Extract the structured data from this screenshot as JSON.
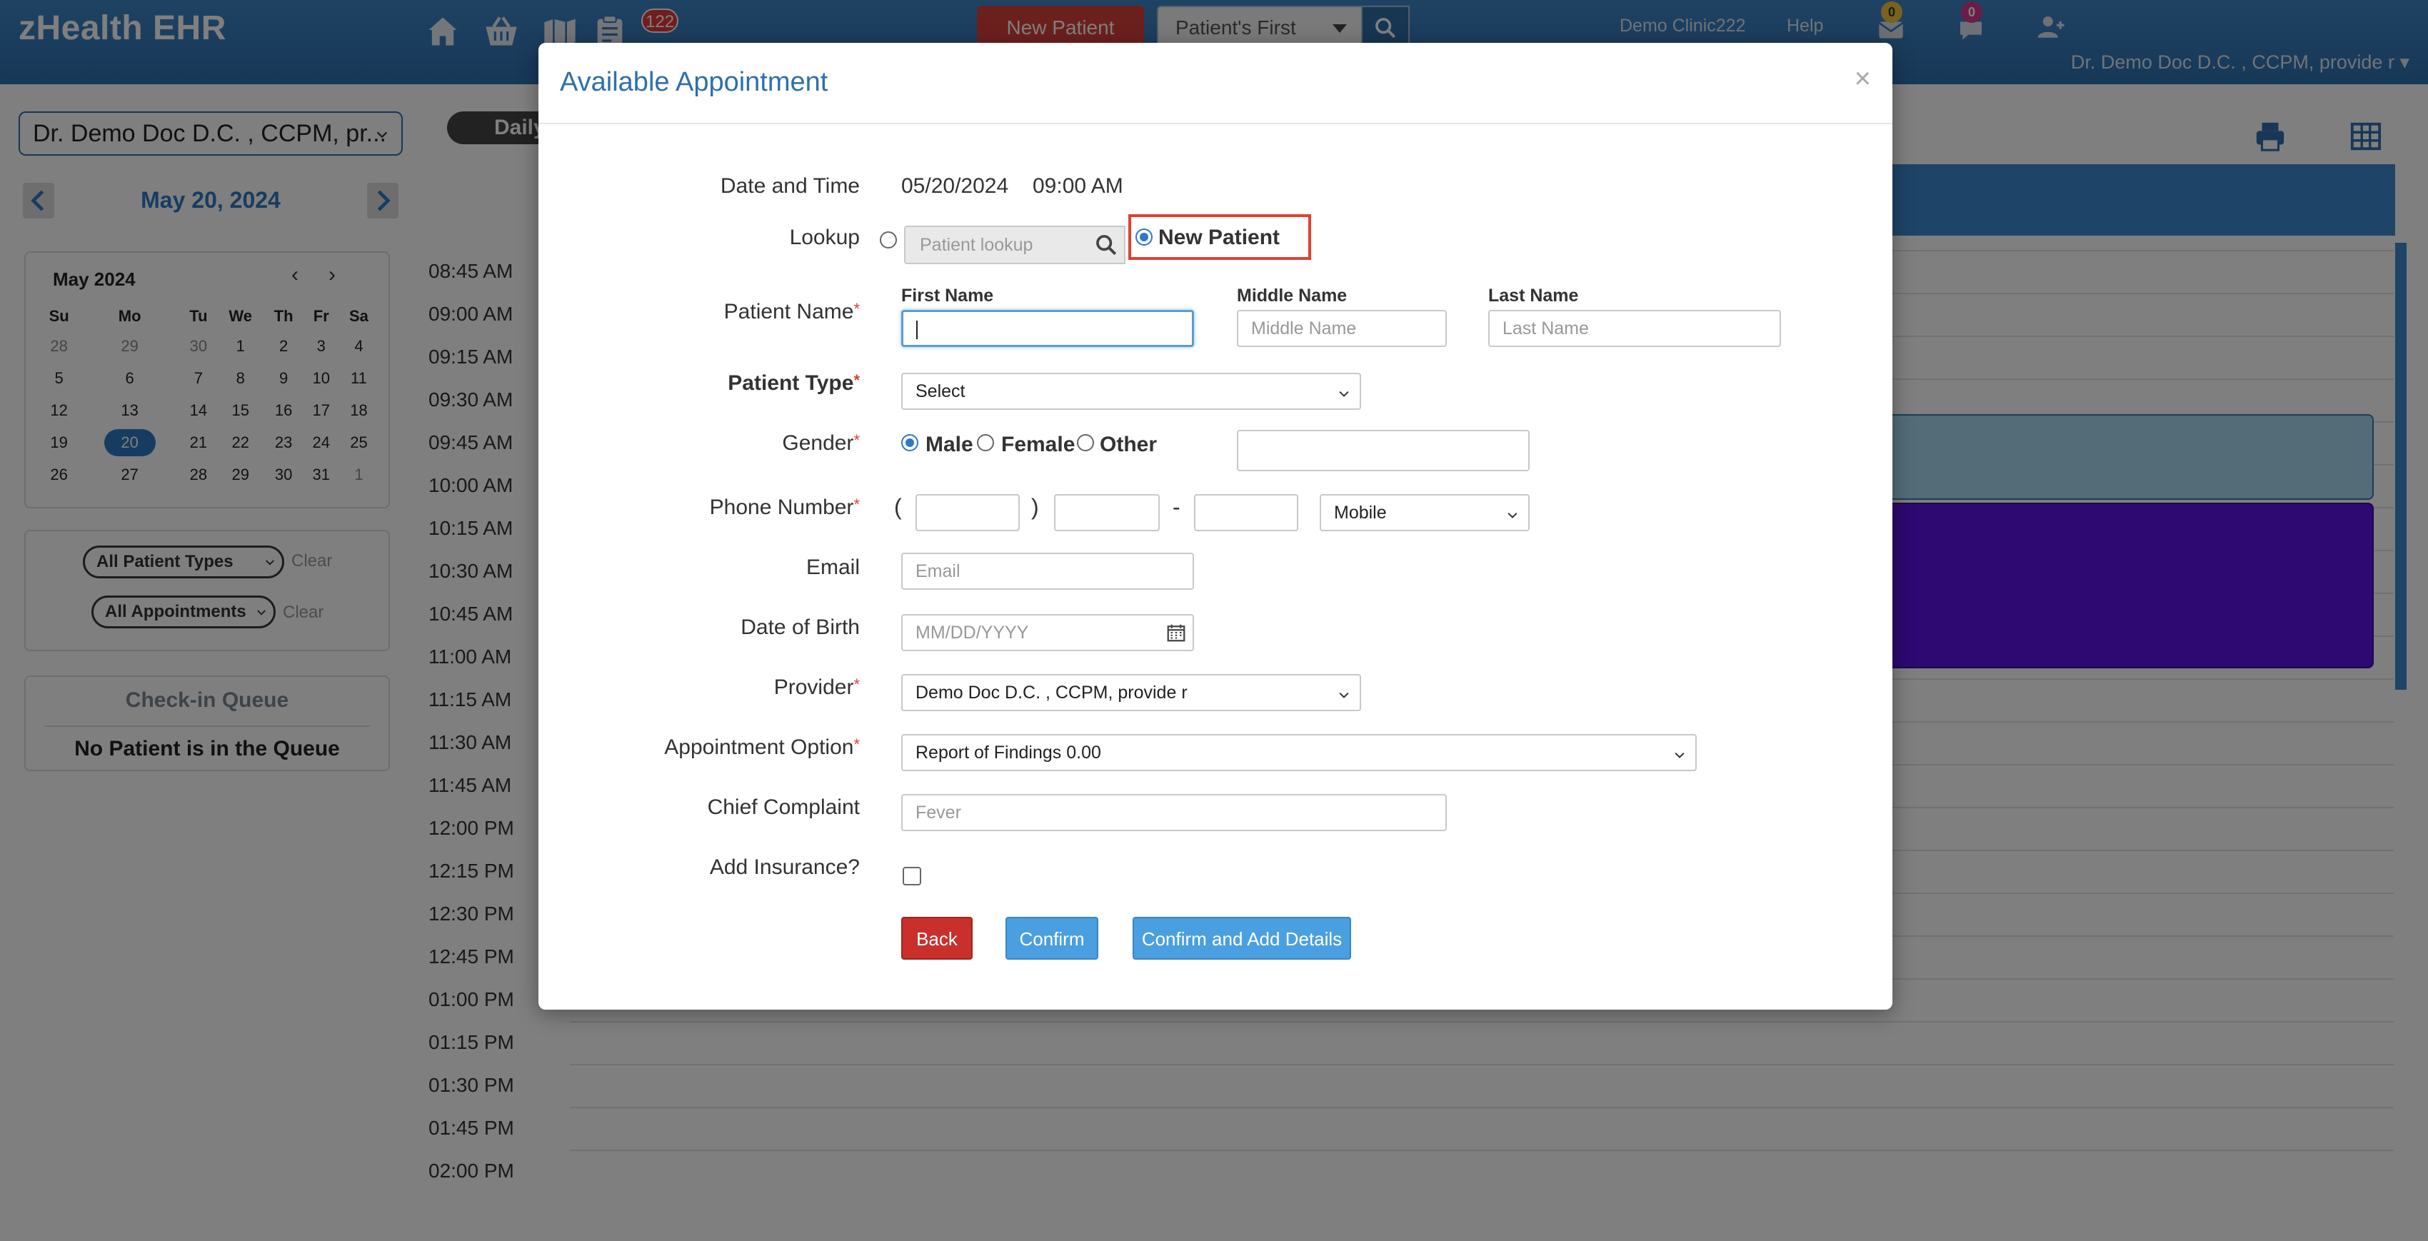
{
  "topbar": {
    "brand": "zHealth EHR",
    "notifications_count": "122",
    "new_patient_label": "New Patient",
    "patient_search_mode": "Patient's First",
    "clinic_name": "Demo Clinic222",
    "help_label": "Help",
    "messages_count": "0",
    "chat_count": "0",
    "user_name": "Dr. Demo Doc D.C. , CCPM, provide r ▾",
    "icons": [
      "home-icon",
      "basket-icon",
      "flag-icon",
      "clipboard-icon",
      "envelope-icon",
      "chat-icon",
      "user-plus-icon",
      "search-icon"
    ]
  },
  "left": {
    "provider": "Dr. Demo Doc D.C. , CCPM, pr...",
    "current_date": "May 20, 2024",
    "mini_calendar": {
      "title": "May 2024",
      "weekdays": [
        "Su",
        "Mo",
        "Tu",
        "We",
        "Th",
        "Fr",
        "Sa"
      ],
      "weeks": [
        [
          "28",
          "29",
          "30",
          "1",
          "2",
          "3",
          "4"
        ],
        [
          "5",
          "6",
          "7",
          "8",
          "9",
          "10",
          "11"
        ],
        [
          "12",
          "13",
          "14",
          "15",
          "16",
          "17",
          "18"
        ],
        [
          "19",
          "20",
          "21",
          "22",
          "23",
          "24",
          "25"
        ],
        [
          "26",
          "27",
          "28",
          "29",
          "30",
          "31",
          "1"
        ]
      ],
      "selected": "20"
    },
    "filters": {
      "patient_types": "All Patient Types",
      "appointments": "All Appointments",
      "clear_label": "Clear"
    },
    "queue": {
      "title": "Check-in Queue",
      "empty_message": "No Patient is in the Queue"
    }
  },
  "schedule": {
    "view_label": "Daily",
    "times": [
      "08:45 AM",
      "09:00 AM",
      "09:15 AM",
      "09:30 AM",
      "09:45 AM",
      "10:00 AM",
      "10:15 AM",
      "10:30 AM",
      "10:45 AM",
      "11:00 AM",
      "11:15 AM",
      "11:30 AM",
      "11:45 AM",
      "12:00 PM",
      "12:15 PM",
      "12:30 PM",
      "12:45 PM",
      "01:00 PM",
      "01:15 PM",
      "01:30 PM",
      "01:45 PM",
      "02:00 PM"
    ]
  },
  "modal": {
    "title": "Available Appointment",
    "close_label": "×",
    "date_time_label": "Date and Time",
    "date_value": "05/20/2024",
    "time_value": "09:00 AM",
    "lookup_label": "Lookup",
    "lookup_placeholder": "Patient lookup",
    "new_patient_label": "New Patient",
    "patient_name_label": "Patient Name",
    "first_name_label": "First Name",
    "middle_name_label": "Middle Name",
    "last_name_label": "Last Name",
    "middle_name_placeholder": "Middle Name",
    "last_name_placeholder": "Last Name",
    "patient_type_label": "Patient Type",
    "patient_type_value": "Select",
    "gender_label": "Gender",
    "gender_options": [
      "Male",
      "Female",
      "Other"
    ],
    "gender_selected": "Male",
    "phone_label": "Phone Number",
    "phone_open_paren": "(",
    "phone_close_paren": ")",
    "phone_dash": "-",
    "phone_type": "Mobile",
    "email_label": "Email",
    "email_placeholder": "Email",
    "dob_label": "Date of Birth",
    "dob_placeholder": "MM/DD/YYYY",
    "provider_label": "Provider",
    "provider_value": "Demo Doc D.C. , CCPM, provide r",
    "appointment_option_label": "Appointment Option",
    "appointment_option_value": "Report of Findings 0.00",
    "chief_complaint_label": "Chief Complaint",
    "chief_complaint_placeholder": "Fever",
    "add_insurance_label": "Add Insurance?",
    "back_label": "Back",
    "confirm_label": "Confirm",
    "confirm_add_label": "Confirm and Add Details"
  },
  "colors": {
    "brand_blue": "#2f6fae",
    "danger_red": "#d9413d",
    "accent_blue": "#4a9fe0",
    "appointment_purple": "#5b12e3",
    "appointment_light": "#a9d9ee"
  }
}
